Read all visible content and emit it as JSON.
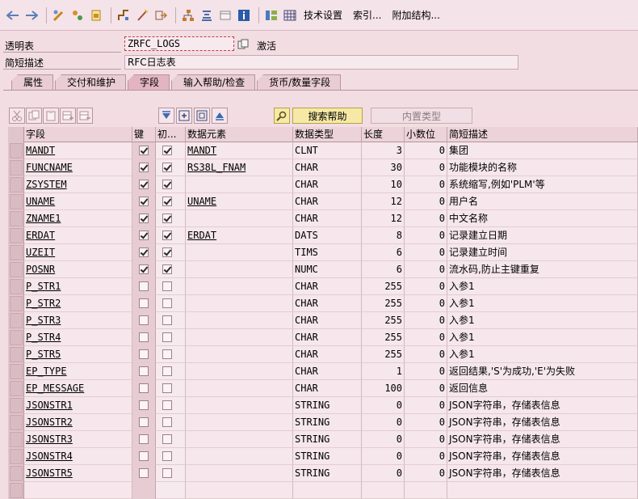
{
  "toolbar": {
    "tech_settings": "技术设置",
    "index": "索引...",
    "append_structure": "附加结构..."
  },
  "header": {
    "table_label": "透明表",
    "table_name": "ZRFC_LOGS",
    "status": "激活",
    "desc_label": "简短描述",
    "description": "RFC日志表"
  },
  "tabs": [
    {
      "label": "属性"
    },
    {
      "label": "交付和维护"
    },
    {
      "label": "字段"
    },
    {
      "label": "输入帮助/检查"
    },
    {
      "label": "货币/数量字段"
    }
  ],
  "active_tab": 2,
  "table_toolbar": {
    "search_help": "搜索帮助",
    "builtin_type": "内置类型"
  },
  "columns": {
    "field": "字段",
    "key": "键",
    "init": "初...",
    "data_element": "数据元素",
    "data_type": "数据类型",
    "length": "长度",
    "decimals": "小数位",
    "short_desc": "简短描述"
  },
  "rows": [
    {
      "field": "MANDT",
      "key": true,
      "init": true,
      "element": "MANDT",
      "type": "CLNT",
      "len": "3",
      "dec": "0",
      "desc": "集团"
    },
    {
      "field": "FUNCNAME",
      "key": true,
      "init": true,
      "element": "RS38L_FNAM",
      "type": "CHAR",
      "len": "30",
      "dec": "0",
      "desc": "功能模块的名称"
    },
    {
      "field": "ZSYSTEM",
      "key": true,
      "init": true,
      "element": "",
      "type": "CHAR",
      "len": "10",
      "dec": "0",
      "desc": "系统缩写,例如'PLM'等"
    },
    {
      "field": "UNAME",
      "key": true,
      "init": true,
      "element": "UNAME",
      "type": "CHAR",
      "len": "12",
      "dec": "0",
      "desc": "用户名"
    },
    {
      "field": "ZNAME1",
      "key": true,
      "init": true,
      "element": "",
      "type": "CHAR",
      "len": "12",
      "dec": "0",
      "desc": "中文名称"
    },
    {
      "field": "ERDAT",
      "key": true,
      "init": true,
      "element": "ERDAT",
      "type": "DATS",
      "len": "8",
      "dec": "0",
      "desc": "记录建立日期"
    },
    {
      "field": "UZEIT",
      "key": true,
      "init": true,
      "element": "",
      "type": "TIMS",
      "len": "6",
      "dec": "0",
      "desc": "记录建立时间"
    },
    {
      "field": "POSNR",
      "key": true,
      "init": true,
      "element": "",
      "type": "NUMC",
      "len": "6",
      "dec": "0",
      "desc": "流水码,防止主键重复"
    },
    {
      "field": "P_STR1",
      "key": false,
      "init": false,
      "element": "",
      "type": "CHAR",
      "len": "255",
      "dec": "0",
      "desc": "入参1"
    },
    {
      "field": "P_STR2",
      "key": false,
      "init": false,
      "element": "",
      "type": "CHAR",
      "len": "255",
      "dec": "0",
      "desc": "入参1"
    },
    {
      "field": "P_STR3",
      "key": false,
      "init": false,
      "element": "",
      "type": "CHAR",
      "len": "255",
      "dec": "0",
      "desc": "入参1"
    },
    {
      "field": "P_STR4",
      "key": false,
      "init": false,
      "element": "",
      "type": "CHAR",
      "len": "255",
      "dec": "0",
      "desc": "入参1"
    },
    {
      "field": "P_STR5",
      "key": false,
      "init": false,
      "element": "",
      "type": "CHAR",
      "len": "255",
      "dec": "0",
      "desc": "入参1"
    },
    {
      "field": "EP_TYPE",
      "key": false,
      "init": false,
      "element": "",
      "type": "CHAR",
      "len": "1",
      "dec": "0",
      "desc": "返回结果,'S'为成功,'E'为失败"
    },
    {
      "field": "EP_MESSAGE",
      "key": false,
      "init": false,
      "element": "",
      "type": "CHAR",
      "len": "100",
      "dec": "0",
      "desc": "返回信息"
    },
    {
      "field": "JSONSTR1",
      "key": false,
      "init": false,
      "element": "",
      "type": "STRING",
      "len": "0",
      "dec": "0",
      "desc": "JSON字符串，存储表信息"
    },
    {
      "field": "JSONSTR2",
      "key": false,
      "init": false,
      "element": "",
      "type": "STRING",
      "len": "0",
      "dec": "0",
      "desc": "JSON字符串，存储表信息"
    },
    {
      "field": "JSONSTR3",
      "key": false,
      "init": false,
      "element": "",
      "type": "STRING",
      "len": "0",
      "dec": "0",
      "desc": "JSON字符串，存储表信息"
    },
    {
      "field": "JSONSTR4",
      "key": false,
      "init": false,
      "element": "",
      "type": "STRING",
      "len": "0",
      "dec": "0",
      "desc": "JSON字符串，存储表信息"
    },
    {
      "field": "JSONSTR5",
      "key": false,
      "init": false,
      "element": "",
      "type": "STRING",
      "len": "0",
      "dec": "0",
      "desc": "JSON字符串，存储表信息"
    }
  ]
}
